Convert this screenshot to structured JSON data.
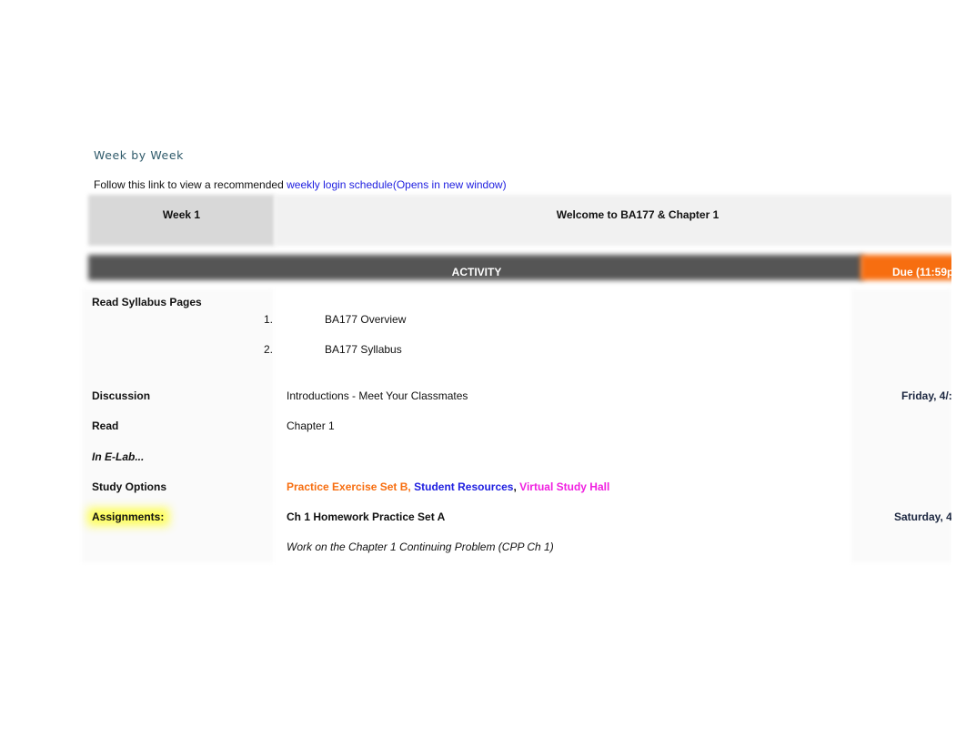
{
  "section_title": "Week by Week",
  "intro": {
    "text": "Follow this link to view a recommended",
    "link_label": "weekly login schedule(Opens in new window)"
  },
  "week_header": {
    "week_label": "Week 1",
    "week_title": "Welcome to BA177 & Chapter 1"
  },
  "table_header": {
    "activity": "ACTIVITY",
    "due": "Due (11:59p"
  },
  "colors": {
    "header_dark": "#555555",
    "header_orange": "#f76e10",
    "link_blue": "#2020e0",
    "magenta": "#f020e0",
    "highlight": "#ffff40"
  },
  "rows": {
    "read_syllabus": {
      "label": "Read Syllabus Pages",
      "items": [
        {
          "num": "1.",
          "title": "BA177 Overview"
        },
        {
          "num": "2.",
          "title": "BA177 Syllabus"
        }
      ]
    },
    "discussion": {
      "label": "Discussion",
      "activity": "Introductions - Meet Your Classmates",
      "due": "Friday, 4/:"
    },
    "read": {
      "label": "Read",
      "activity": "Chapter 1"
    },
    "elab": {
      "label": "In E-Lab..."
    },
    "study_options": {
      "label": "Study Options",
      "links": [
        {
          "text": "Practice Exercise Set B,"
        },
        {
          "text": "Student Resources"
        },
        {
          "text": ","
        },
        {
          "text": "Virtual Study Hall"
        }
      ]
    },
    "assignments": {
      "label": "Assignments:",
      "activity": "Ch 1 Homework Practice Set A",
      "due": "Saturday, 4",
      "note": "Work on the Chapter 1 Continuing Problem (CPP Ch 1)"
    }
  }
}
